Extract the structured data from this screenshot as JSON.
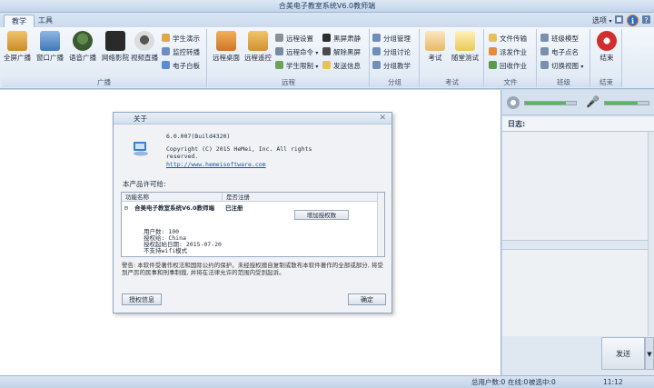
{
  "window": {
    "title": "合美电子教室系统V6.0教师端"
  },
  "tabs": [
    {
      "label": "教学"
    },
    {
      "label": "工具"
    }
  ],
  "top_right": {
    "options_label": "选项"
  },
  "ribbon": {
    "broadcast": {
      "group_label": "广播",
      "big": [
        "全屏广播",
        "窗口广播",
        "语音广播",
        "网络影院",
        "视频直播"
      ],
      "small": [
        "学生演示",
        "监控转播",
        "电子白板"
      ]
    },
    "remote": {
      "group_label": "远程",
      "big": [
        "远程桌面",
        "远程遥控"
      ],
      "small": [
        "远程设置",
        "远程命令",
        "学生限制",
        "黑屏肃静",
        "解除黑屏",
        "发送信息"
      ]
    },
    "grouping": {
      "group_label": "分组",
      "small": [
        "分组管理",
        "分组讨论",
        "分组教学"
      ]
    },
    "exam": {
      "group_label": "考试",
      "big": [
        "考试",
        "随堂测试"
      ]
    },
    "files": {
      "group_label": "文件",
      "small": [
        "文件传输",
        "派发作业",
        "回收作业"
      ]
    },
    "class": {
      "group_label": "班级",
      "small": [
        "班级模型",
        "电子点名",
        "切换视图"
      ]
    },
    "end": {
      "group_label": "结束",
      "big": [
        "结束"
      ]
    }
  },
  "right_panel": {
    "log_label": "日志:",
    "send_label": "发送",
    "volume_level": 0.8,
    "mic_level": 0.75
  },
  "status": {
    "total_users": "总用户数:0",
    "online": "在线:0",
    "selected": "被选中:0",
    "time": "11:12"
  },
  "about_dialog": {
    "title": "关于",
    "version": "6.0.007(Build4320)",
    "copyright_line1": "Copyright (C) 2015 HeMei, Inc. All rights",
    "copyright_line2": "reserved.",
    "link": "http://www.hemeisoftware.com",
    "license_label": "本产品许可给:",
    "col_function": "功能名称",
    "col_registered": "是否注册",
    "product_name": "合美电子教室系统V6.0教师端",
    "registered_value": "已注册",
    "add_license_button": "增加授权数",
    "details": [
      "用户数: 100",
      "授权给: China",
      "授权起始日期: 2015-07-20",
      "不支持wifi模式"
    ],
    "warning": "警告: 本软件受著作权法和国际公约的保护。未经授权擅自复制或散布本软件著作的全部或部分, 将受到严厉的民事和刑事制裁, 并将在法律允许的范围内受到起诉。",
    "license_info_button": "授权信息",
    "ok_button": "确定"
  }
}
